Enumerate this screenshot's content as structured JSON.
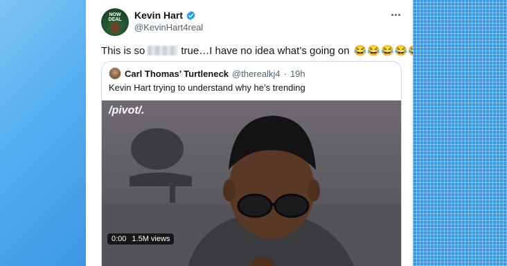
{
  "tweet": {
    "display_name": "Kevin Hart",
    "handle": "@KevinHart4real",
    "avatar_text": "NOW DEAL",
    "text_before": "This is so",
    "text_after": "true…I have no idea what’s going on",
    "emojis": "😂😂😂😂😂😂"
  },
  "quoted": {
    "display_name": "Carl Thomas’ Turtleneck",
    "handle": "@therealkj4",
    "separator": "·",
    "time": "19h",
    "text": "Kevin Hart trying to understand why he’s trending",
    "watermark": "/pivot/.",
    "video_time": "0:00",
    "views": "1.5M views"
  },
  "colors": {
    "verified": "#1d9bf0",
    "text_primary": "#0f1419",
    "text_secondary": "#536471",
    "border": "#cfd9de"
  },
  "icons": {
    "verified": "verified-badge-icon",
    "more": "more-options-icon"
  }
}
